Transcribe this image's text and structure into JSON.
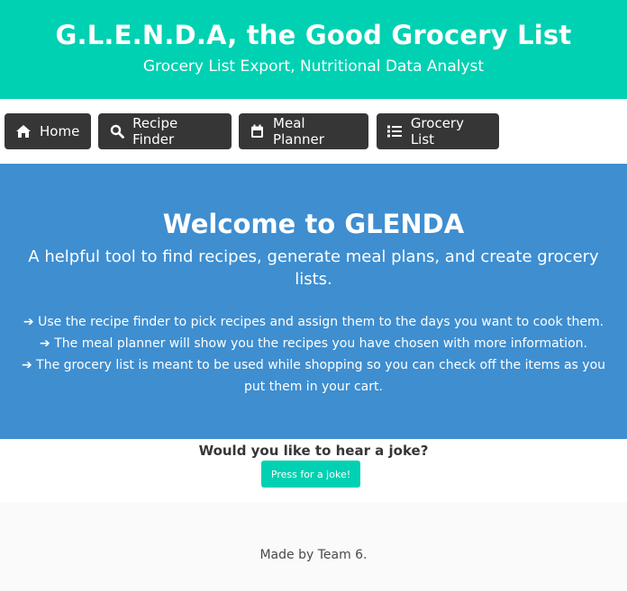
{
  "header": {
    "title": "G.L.E.N.D.A, the Good Grocery List",
    "subtitle": "Grocery List Export, Nutritional Data Analyst"
  },
  "nav": {
    "items": [
      {
        "label": "Home",
        "icon": "home-icon"
      },
      {
        "label": "Recipe Finder",
        "icon": "search-icon"
      },
      {
        "label": "Meal Planner",
        "icon": "calendar-icon"
      },
      {
        "label": "Grocery List",
        "icon": "list-icon"
      }
    ]
  },
  "welcome": {
    "title": "Welcome to GLENDA",
    "subtitle": "A helpful tool to find recipes, generate meal plans, and create grocery lists.",
    "bullets": [
      "Use the recipe finder to pick recipes and assign them to the days you want to cook them.",
      "The meal planner will show you the recipes you have chosen with more information.",
      "The grocery list is meant to be used while shopping so you can check off the items as you put them in your cart."
    ]
  },
  "joke": {
    "question": "Would you like to hear a joke?",
    "button_label": "Press for a joke!"
  },
  "footer": {
    "text": "Made by Team 6."
  },
  "colors": {
    "primary": "#00d1b2",
    "info": "#3e8ed0",
    "dark": "#363636"
  }
}
